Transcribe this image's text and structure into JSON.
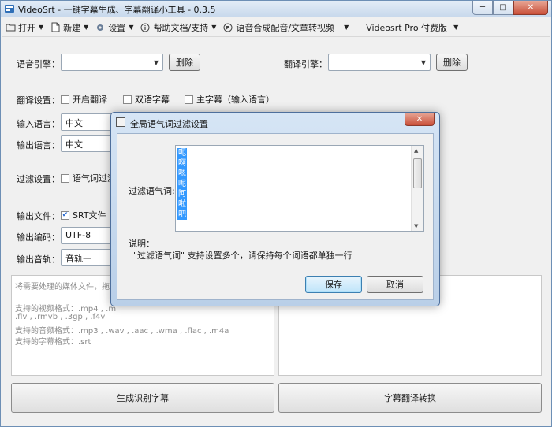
{
  "window": {
    "title": "VideoSrt - 一键字幕生成、字幕翻译小工具 - 0.3.5",
    "minimize": "─",
    "maximize": "□",
    "close": "✕"
  },
  "menu": {
    "open": "打开",
    "new": "新建",
    "settings": "设置",
    "help": "帮助文档/支持",
    "tts": "语音合成配音/文章转视频",
    "pro": "Videosrt Pro 付费版"
  },
  "form": {
    "speech_engine_label": "语音引擎：",
    "speech_engine_value": "",
    "delete_label": "删除",
    "translate_engine_label": "翻译引擎：",
    "translate_engine_value": "",
    "translate_settings_label": "翻译设置：",
    "enable_translate": "开启翻译",
    "bilingual": "双语字幕",
    "main_subtitle": "主字幕（输入语言）",
    "input_lang_label": "输入语言：",
    "input_lang_value": "中文",
    "output_lang_label": "输出语言：",
    "output_lang_value": "中文",
    "filter_label": "过滤设置：",
    "filter_option": "语气词过滤",
    "output_file_label": "输出文件：",
    "output_file_option": "SRT文件",
    "output_encoding_label": "输出编码：",
    "output_encoding_value": "UTF-8",
    "output_track_label": "输出音轨：",
    "output_track_value": "音轨一"
  },
  "left_panel": {
    "lines": [
      "将需要处理的媒体文件，拖",
      "",
      "支持的视频格式：.mp4 , .m",
      ".flv , .rmvb , .3gp , .f4v",
      "支持的音频格式：.mp3 , .wav , .aac , .wma , .flac , .m4a",
      "支持的字幕格式：.srt"
    ]
  },
  "buttons": {
    "generate": "生成识别字幕",
    "translate": "字幕翻译转换"
  },
  "dialog": {
    "title": "全局语气词过滤设置",
    "close": "✕",
    "field_label": "过滤语气词:",
    "words": [
      "呃",
      "啊",
      "嗯",
      "呢",
      "阿",
      "啦",
      "吧"
    ],
    "note_title": "说明：",
    "note_text": "\"过滤语气词\"  支持设置多个，请保持每个词语都单独一行",
    "save": "保存",
    "cancel": "取消"
  },
  "colors": {
    "selection": "#3399ff",
    "titlebar": "#c8d9ec",
    "close_button": "#c9503a"
  }
}
